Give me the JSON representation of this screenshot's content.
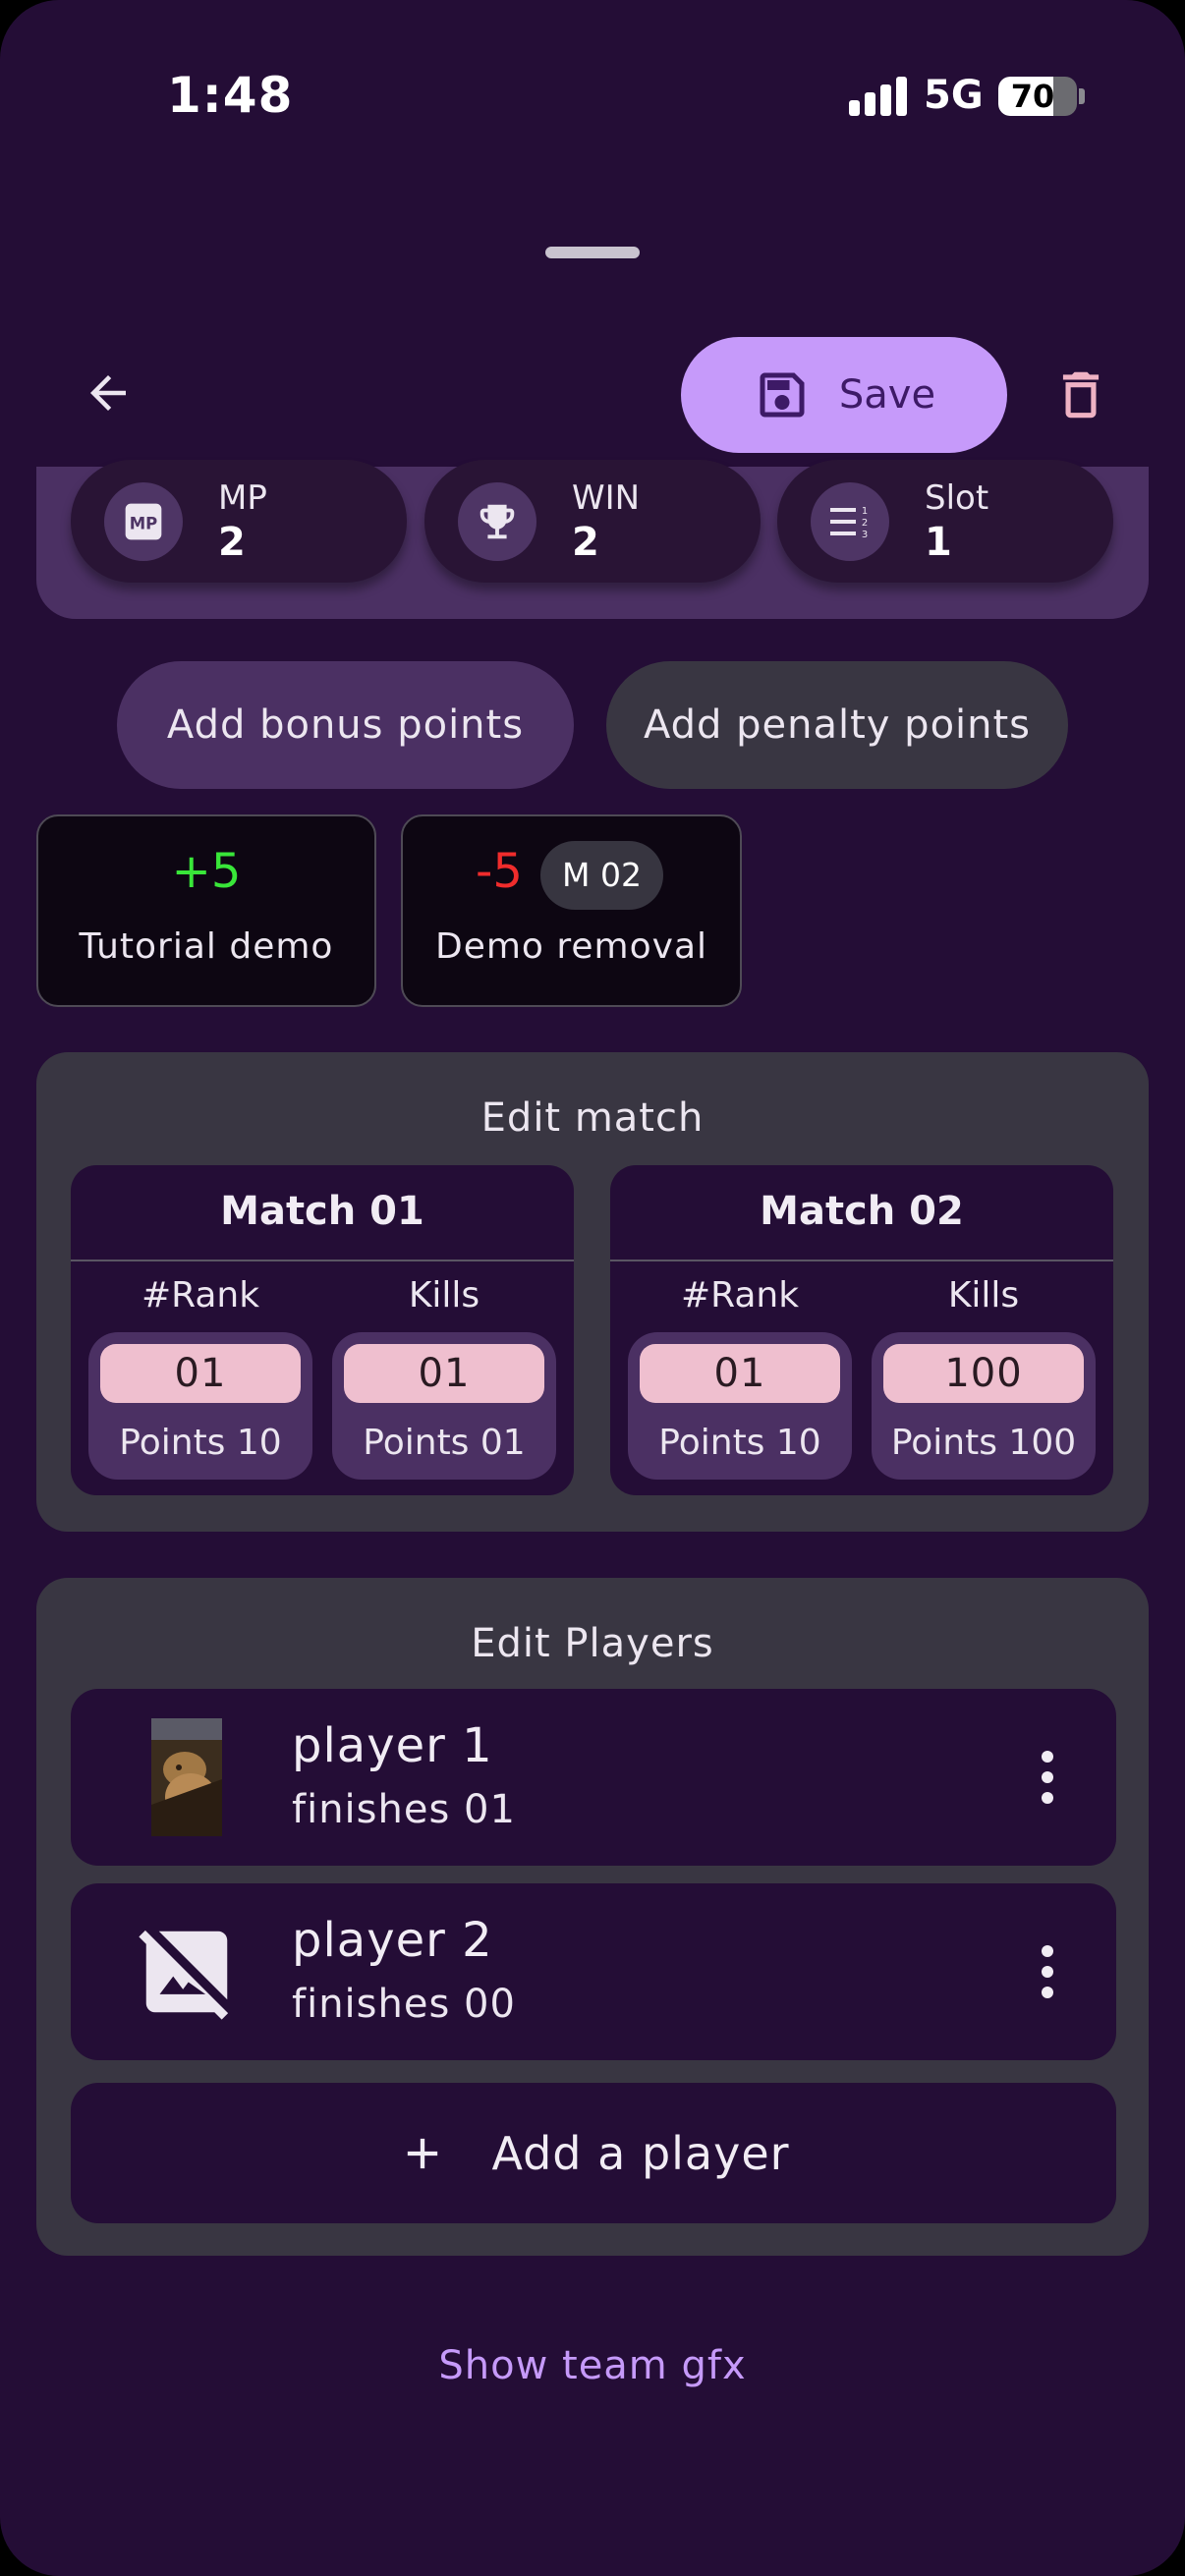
{
  "status_bar": {
    "time": "1:48",
    "network": "5G",
    "battery": "70",
    "battery_level": 0.7
  },
  "header": {
    "save_label": "Save"
  },
  "stats": [
    {
      "label": "MP",
      "value": "2",
      "icon": "mp-icon"
    },
    {
      "label": "WIN",
      "value": "2",
      "icon": "trophy-icon"
    },
    {
      "label": "Slot",
      "value": "1",
      "icon": "numbered-list-icon"
    }
  ],
  "actions": {
    "bonus_label": "Add bonus points",
    "penalty_label": "Add penalty points"
  },
  "point_entries": [
    {
      "value": "+5",
      "description": "Tutorial demo",
      "color": "#39e639"
    },
    {
      "value": "-5",
      "badge": "M 02",
      "description": "Demo removal",
      "color": "#f02c2c"
    }
  ],
  "edit_match": {
    "title": "Edit match",
    "rank_label": "#Rank",
    "kills_label": "Kills",
    "matches": [
      {
        "title": "Match 01",
        "rank": "01",
        "rank_points": "Points 10",
        "kills": "01",
        "kill_points": "Points 01"
      },
      {
        "title": "Match 02",
        "rank": "01",
        "rank_points": "Points 10",
        "kills": "100",
        "kill_points": "Points 100"
      }
    ]
  },
  "edit_players": {
    "title": "Edit Players",
    "players": [
      {
        "name": "player 1",
        "finishes": "finishes 01"
      },
      {
        "name": "player 2",
        "finishes": "finishes 00"
      }
    ],
    "add_label": "Add a player"
  },
  "footer": {
    "gfx_link": "Show team gfx"
  },
  "colors": {
    "background": "#240d36",
    "accent": "#c69afa",
    "surface": "#393642",
    "tonal": "#4b3063",
    "field": "#efbfcf"
  }
}
